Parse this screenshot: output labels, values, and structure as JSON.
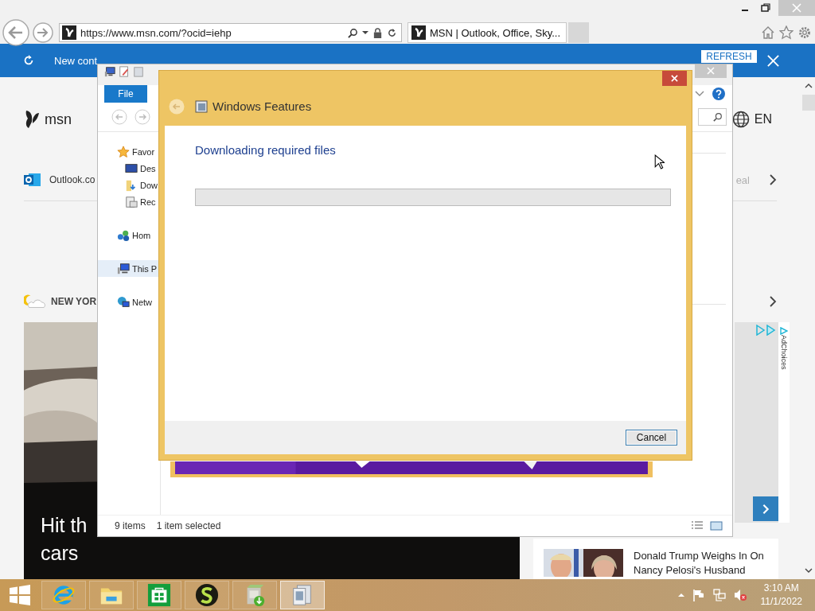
{
  "browser": {
    "url": "https://www.msn.com/?ocid=iehp",
    "tab_title": "MSN | Outlook, Office, Sky..."
  },
  "notification": {
    "text": "New cont",
    "button": "REFRESH"
  },
  "page": {
    "logo": "msn",
    "language": "EN",
    "shortcut": "Outlook.co",
    "shortcut_right": "eal",
    "weather": "NEW YOR",
    "adchoices": "AdChoices",
    "hero": {
      "kind": "picture",
      "headline_lines": [
        "Hit th",
        "cars"
      ]
    },
    "news": {
      "kind": "picture",
      "headline": "Donald Trump Weighs In On Nancy Pelosi's Husband"
    }
  },
  "explorer": {
    "ribbon_tab": "File",
    "nav": [
      {
        "label": "Favor",
        "kind": "star",
        "selected": false,
        "children": [
          {
            "label": "Des",
            "kind": "desktop",
            "selected": false
          },
          {
            "label": "Dow",
            "kind": "downloads",
            "selected": false
          },
          {
            "label": "Rec",
            "kind": "recent",
            "selected": false
          }
        ]
      },
      {
        "label": "Hom",
        "kind": "homegroup",
        "selected": false
      },
      {
        "label": "This P",
        "kind": "computer",
        "selected": true
      },
      {
        "label": "Netw",
        "kind": "network",
        "selected": false
      }
    ],
    "status": [
      "9 items",
      "1 item selected"
    ]
  },
  "dialog": {
    "title": "Windows Features",
    "heading": "Downloading required files",
    "progress": {
      "level": 0
    },
    "buttons": [
      "Cancel"
    ]
  },
  "taskbar": {
    "apps": [
      {
        "kind": "ie",
        "selected": false
      },
      {
        "kind": "explorer",
        "selected": false
      },
      {
        "kind": "store",
        "selected": false
      },
      {
        "kind": "s-app",
        "selected": false
      },
      {
        "kind": "installer",
        "selected": false
      },
      {
        "kind": "features",
        "selected": true
      }
    ],
    "clock": {
      "time": "3:10 AM",
      "date": "11/1/2022"
    }
  }
}
